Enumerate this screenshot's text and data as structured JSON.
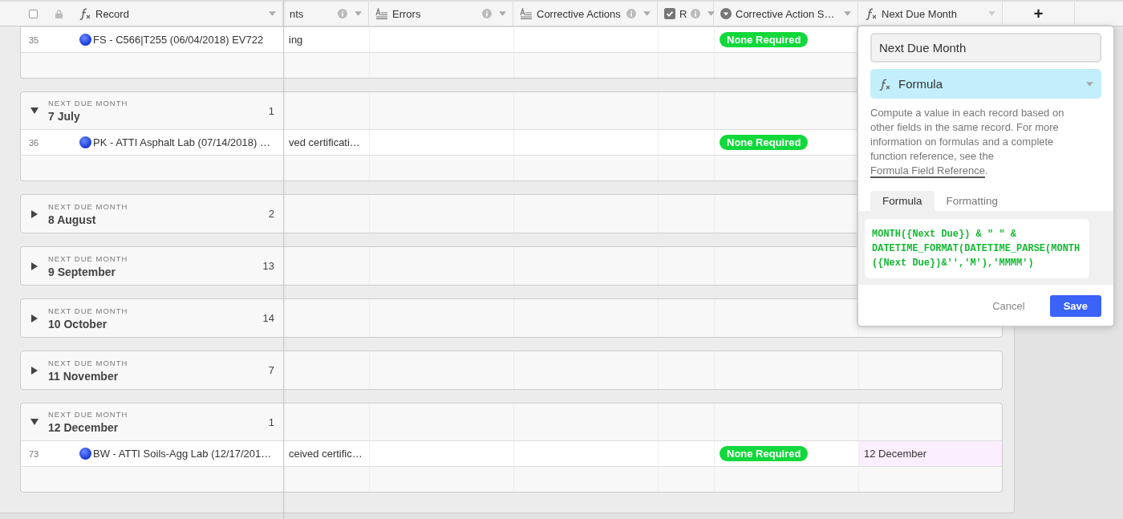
{
  "header": {
    "select_all": {
      "checked": false
    },
    "columns": [
      {
        "label": "Record",
        "kind": "formula",
        "info": false,
        "selected": false
      },
      {
        "label": "nts",
        "kind": "none",
        "info": true,
        "selected": false
      },
      {
        "label": "Errors",
        "kind": "long_text",
        "info": true,
        "selected": false
      },
      {
        "label": "Corrective Actions",
        "kind": "long_text",
        "info": true,
        "selected": false
      },
      {
        "label": "R",
        "kind": "checkbox",
        "info": true,
        "selected": false
      },
      {
        "label": "Corrective Action S…",
        "kind": "single_select",
        "info": false,
        "selected": false
      },
      {
        "label": "Next Due Month",
        "kind": "formula",
        "info": false,
        "selected": true
      }
    ],
    "add_column": "+"
  },
  "scrolled_group": {
    "rows": [
      {
        "number": "35",
        "record": "FS - C566|T255 (06/04/2018) EV722",
        "column_2": "ing",
        "status": "None Required"
      }
    ]
  },
  "groups": [
    {
      "label": "NEXT DUE MONTH",
      "title": "7 July",
      "count": "1",
      "expanded": true,
      "rows": [
        {
          "number": "36",
          "record": "PK - ATTI Asphalt Lab (07/14/2018) …",
          "column_2": "ved certificati…",
          "status": "None Required"
        }
      ]
    },
    {
      "label": "NEXT DUE MONTH",
      "title": "8 August",
      "count": "2",
      "expanded": false
    },
    {
      "label": "NEXT DUE MONTH",
      "title": "9 September",
      "count": "13",
      "expanded": false
    },
    {
      "label": "NEXT DUE MONTH",
      "title": "10 October",
      "count": "14",
      "expanded": false
    },
    {
      "label": "NEXT DUE MONTH",
      "title": "11 November",
      "count": "7",
      "expanded": false
    },
    {
      "label": "NEXT DUE MONTH",
      "title": "12 December",
      "count": "1",
      "expanded": true,
      "rows": [
        {
          "number": "73",
          "record": "BW - ATTI Soils-Agg Lab (12/17/201…",
          "column_2": "ceived certific…",
          "status": "None Required",
          "next_due_month": "12 December"
        }
      ]
    }
  ],
  "field_editor": {
    "name": "Next Due Month",
    "type": "Formula",
    "description": "Compute a value in each record based on other fields in the same record. For more information on formulas and a complete function reference, see the ",
    "link": "Formula Field Reference",
    "description_end": ".",
    "tabs": [
      {
        "label": "Formula",
        "selected": true
      },
      {
        "label": "Formatting",
        "selected": false
      }
    ],
    "formula": "MONTH({Next Due}) & \" \" & DATETIME_FORMAT(DATETIME_PARSE(MONTH({Next Due})&'','M'),'MMMM')",
    "buttons": [
      {
        "label": "Cancel",
        "kind": "secondary"
      },
      {
        "label": "Save",
        "kind": "primary"
      }
    ]
  }
}
